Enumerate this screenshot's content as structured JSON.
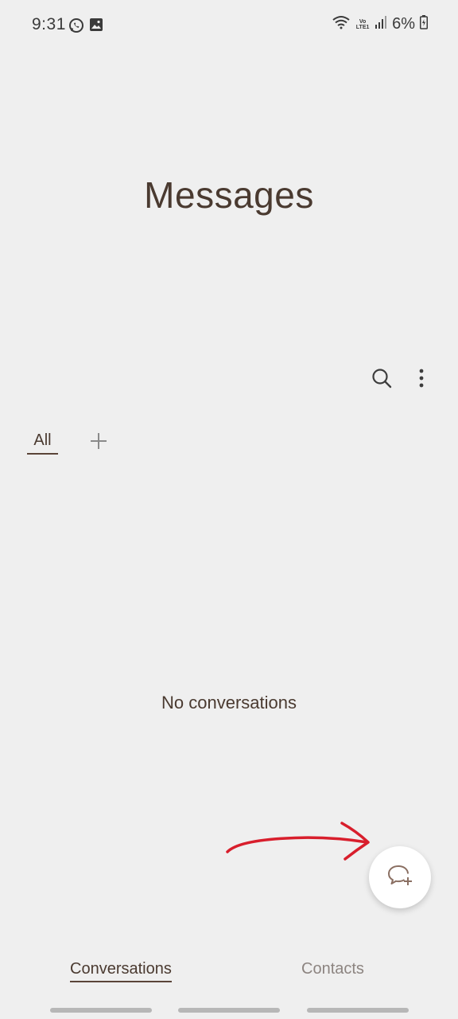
{
  "status_bar": {
    "time": "9:31",
    "battery": "6%",
    "network_label": "Vo LTE1",
    "left_icons": [
      "whatsapp-icon",
      "gallery-icon"
    ],
    "right_icons": [
      "wifi-icon",
      "volte-icon",
      "signal-icon",
      "battery-icon"
    ]
  },
  "header": {
    "title": "Messages"
  },
  "toolbar": {
    "icons": [
      "search-icon",
      "more-options-icon"
    ]
  },
  "filter_tabs": {
    "items": [
      {
        "label": "All",
        "selected": true
      }
    ],
    "add_icon": "plus-icon"
  },
  "main": {
    "empty_state": "No conversations"
  },
  "fab": {
    "icon": "new-chat-icon"
  },
  "annotation": {
    "type": "hand-drawn arrow",
    "color": "#d81e2c"
  },
  "bottom_nav": {
    "tabs": [
      {
        "label": "Conversations",
        "active": true
      },
      {
        "label": "Contacts",
        "active": false
      }
    ]
  },
  "colors": {
    "background": "#efefef",
    "text_primary": "#4a3a30",
    "text_inactive": "#8c8480",
    "accent_underline": "#5a4438"
  }
}
